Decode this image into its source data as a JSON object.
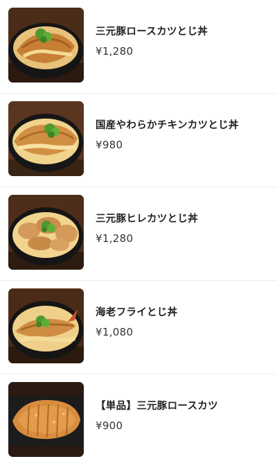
{
  "menu": {
    "items": [
      {
        "name": "三元豚ロースカツとじ丼",
        "price": "¥1,280",
        "image": "katsudon-pork-loin-image"
      },
      {
        "name": "国産やわらかチキンカツとじ丼",
        "price": "¥980",
        "image": "chicken-katsudon-image"
      },
      {
        "name": "三元豚ヒレカツとじ丼",
        "price": "¥1,280",
        "image": "pork-fillet-katsudon-image"
      },
      {
        "name": "海老フライとじ丼",
        "price": "¥1,080",
        "image": "fried-shrimp-don-image"
      },
      {
        "name": "【単品】三元豚ロースカツ",
        "price": "¥900",
        "image": "pork-loin-cutlet-image"
      }
    ]
  },
  "colors": {
    "separator": "#ececec",
    "name_text": "#222222",
    "price_text": "#333333",
    "bowl": "#1a1a1a",
    "cutlet": "#c8843a",
    "egg": "#f3d27a",
    "scallion": "#4f9a2e"
  }
}
